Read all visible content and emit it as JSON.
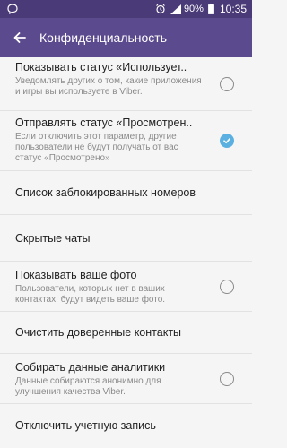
{
  "status_bar": {
    "battery_percent": "90%",
    "time": "10:35",
    "icons": [
      "viber-icon",
      "alarm-icon",
      "signal-icon",
      "battery-icon"
    ]
  },
  "toolbar": {
    "title": "Конфиденциальность",
    "back_icon": "arrow-left-icon"
  },
  "rows": [
    {
      "title": "Показывать статус «Использует..",
      "desc": "Уведомлять других о том, какие приложения и игры вы используете в Viber.",
      "control": "checkbox",
      "checked": false
    },
    {
      "title": "Отправлять статус «Просмотрен..",
      "desc": "Если отключить этот параметр, другие пользователи не будут получать от вас статус «Просмотрено»",
      "control": "checkbox",
      "checked": true
    },
    {
      "title": "Список заблокированных номеров"
    },
    {
      "title": "Скрытые чаты"
    },
    {
      "title": "Показывать ваше фото",
      "desc": "Пользователи, которых нет в ваших контактах, будут видеть ваше фото.",
      "control": "checkbox",
      "checked": false
    },
    {
      "title": "Очистить доверенные контакты"
    },
    {
      "title": "Собирать данные аналитики",
      "desc": "Данные собираются анонимно для улучшения качества Viber.",
      "control": "checkbox",
      "checked": false
    },
    {
      "title": "Отключить учетную запись"
    }
  ],
  "colors": {
    "status_bar": "#4a3a77",
    "toolbar": "#5c4a8f",
    "accent_check": "#5ab0e0"
  }
}
